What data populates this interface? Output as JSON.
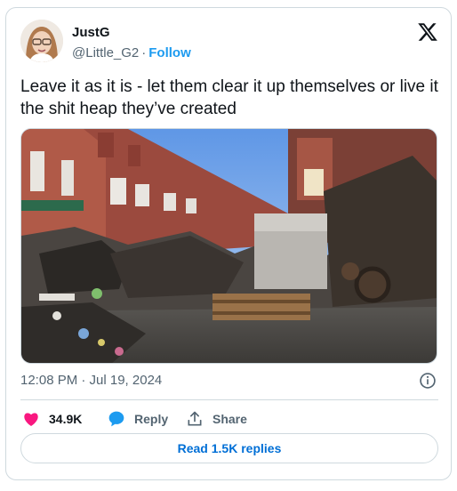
{
  "author": {
    "name": "JustG",
    "handle": "@Little_G2",
    "separator": "·",
    "follow_label": "Follow"
  },
  "tweet": {
    "text": "Leave it as it is - let them clear it up themselves or live it the shit heap they’ve created"
  },
  "meta": {
    "timestamp": "12:08 PM · Jul 19, 2024"
  },
  "actions": {
    "like_count": "34.9K",
    "reply_label": "Reply",
    "share_label": "Share"
  },
  "replies_button": {
    "label": "Read 1.5K replies"
  },
  "colors": {
    "accent": "#1d9bf0",
    "like": "#f91880",
    "text_secondary": "#536471",
    "border": "#cfd9de"
  },
  "icons": [
    "x-logo-icon",
    "heart-icon",
    "reply-bubble-icon",
    "share-icon",
    "info-icon"
  ]
}
